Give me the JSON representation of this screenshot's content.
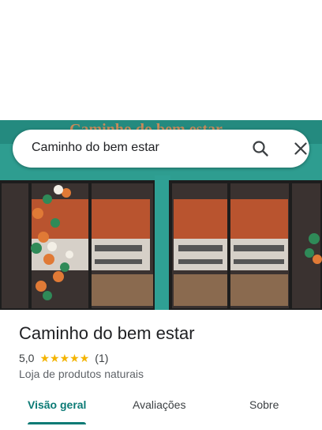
{
  "search": {
    "query": "Caminho do bem estar"
  },
  "place": {
    "name": "Caminho do bem estar",
    "rating": "5,0",
    "stars": 5,
    "review_count": "(1)",
    "category": "Loja de produtos naturais"
  },
  "tabs": [
    {
      "label": "Visão geral",
      "active": true
    },
    {
      "label": "Avaliações",
      "active": false
    },
    {
      "label": "Sobre",
      "active": false
    }
  ],
  "photo": {
    "sign_text": "Caminho do bem estar"
  },
  "colors": {
    "accent": "#0b7a75",
    "star": "#f4b400",
    "storefront": "#2a9a8e"
  }
}
